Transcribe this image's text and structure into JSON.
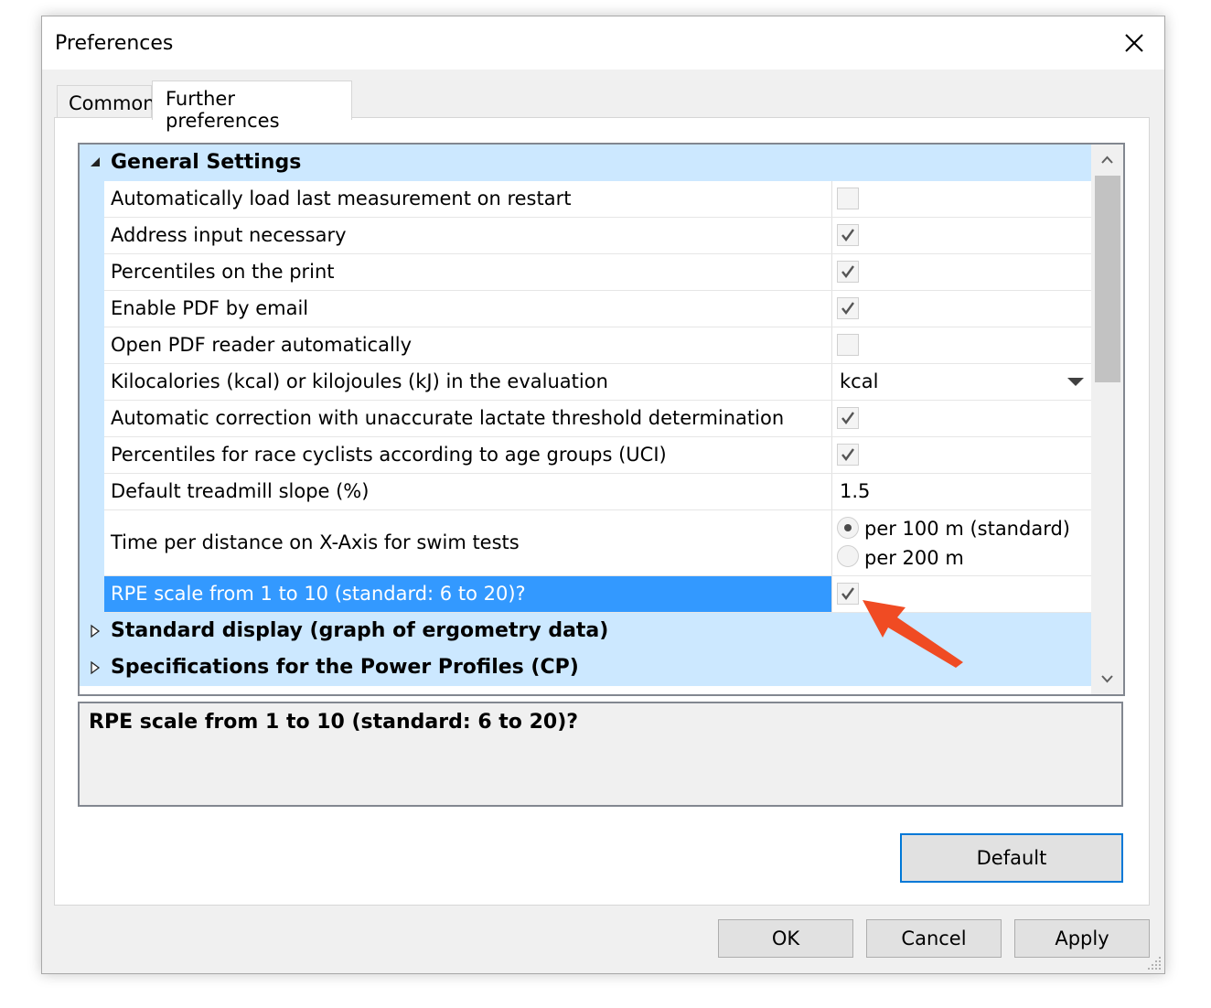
{
  "window": {
    "title": "Preferences"
  },
  "tabs": [
    {
      "label": "Common",
      "active": false
    },
    {
      "label": "Further preferences",
      "active": true
    }
  ],
  "grid": {
    "categories": [
      {
        "label": "General Settings",
        "expanded": true,
        "properties": [
          {
            "name": "Automatically load last measurement on restart",
            "type": "checkbox",
            "checked": false
          },
          {
            "name": "Address input necessary",
            "type": "checkbox",
            "checked": true
          },
          {
            "name": "Percentiles on the print",
            "type": "checkbox",
            "checked": true
          },
          {
            "name": "Enable PDF by email",
            "type": "checkbox",
            "checked": true
          },
          {
            "name": "Open PDF reader automatically",
            "type": "checkbox",
            "checked": false
          },
          {
            "name": "Kilocalories (kcal) or kilojoules (kJ) in the evaluation",
            "type": "dropdown",
            "value": "kcal"
          },
          {
            "name": "Automatic correction with unaccurate lactate threshold determination",
            "type": "checkbox",
            "checked": true
          },
          {
            "name": "Percentiles for race cyclists according to age groups (UCI)",
            "type": "checkbox",
            "checked": true
          },
          {
            "name": "Default treadmill slope (%)",
            "type": "text",
            "value": "1.5"
          },
          {
            "name": "Time per distance on X-Axis for swim tests",
            "type": "radio",
            "options": [
              "per 100 m (standard)",
              "per 200 m"
            ],
            "selected": 0
          },
          {
            "name": "RPE scale from 1 to 10 (standard: 6 to 20)?",
            "type": "checkbox",
            "checked": true,
            "selected": true
          }
        ]
      },
      {
        "label": "Standard display (graph of ergometry data)",
        "expanded": false
      },
      {
        "label": "Specifications for the Power Profiles (CP)",
        "expanded": false
      }
    ]
  },
  "description": {
    "text": "RPE scale from 1 to 10 (standard: 6 to 20)?"
  },
  "buttons": {
    "default": "Default",
    "ok": "OK",
    "cancel": "Cancel",
    "apply": "Apply"
  },
  "colors": {
    "category_bg": "#cce8ff",
    "selection": "#3399ff",
    "default_button_border": "#0078d7",
    "annotation_arrow": "#f04b23"
  }
}
